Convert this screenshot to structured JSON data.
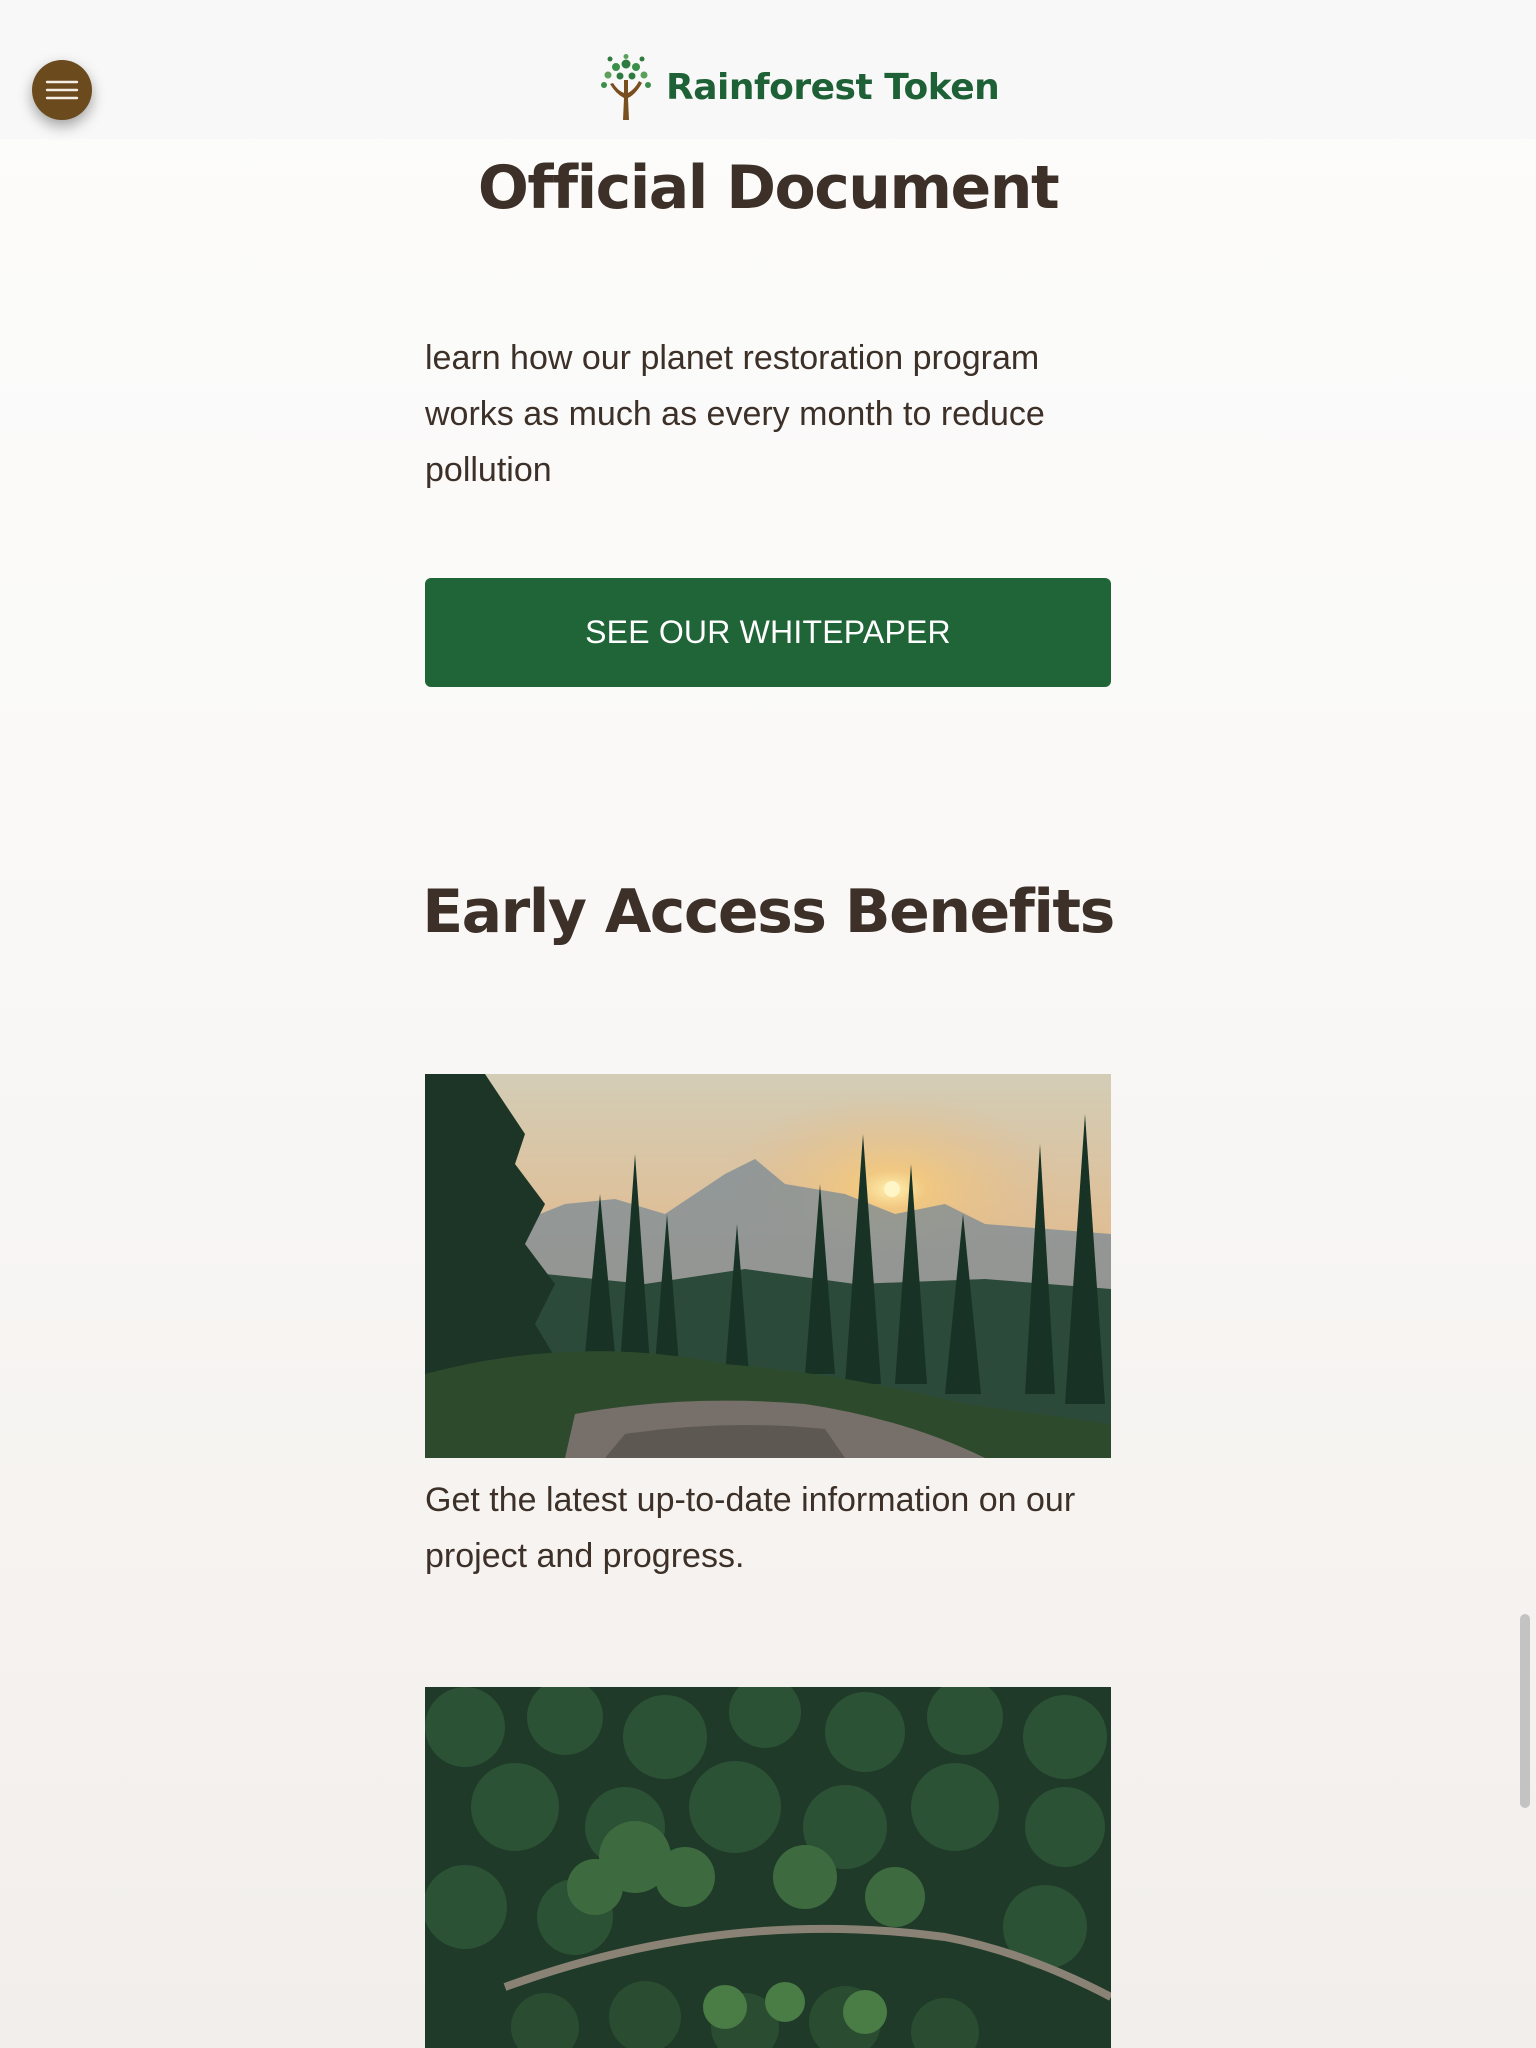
{
  "header": {
    "brand_name": "Rainforest Token",
    "menu_icon": "hamburger-icon",
    "logo_icon": "tree-icon",
    "brand_color": "#1e6136",
    "menu_color": "#6b4a1e"
  },
  "official_document": {
    "title": "Official Document",
    "text": "learn how our planet restoration program works as much as every month to reduce pollution",
    "button_label": "SEE OUR WHITEPAPER",
    "button_color": "#1f6537"
  },
  "benefits": {
    "title": "Early Access Benefits",
    "items": [
      {
        "image": "mountain-forest-sunset-photo",
        "text": "Get the latest up-to-date information on our project and progress."
      },
      {
        "image": "aerial-forest-road-photo"
      }
    ]
  }
}
